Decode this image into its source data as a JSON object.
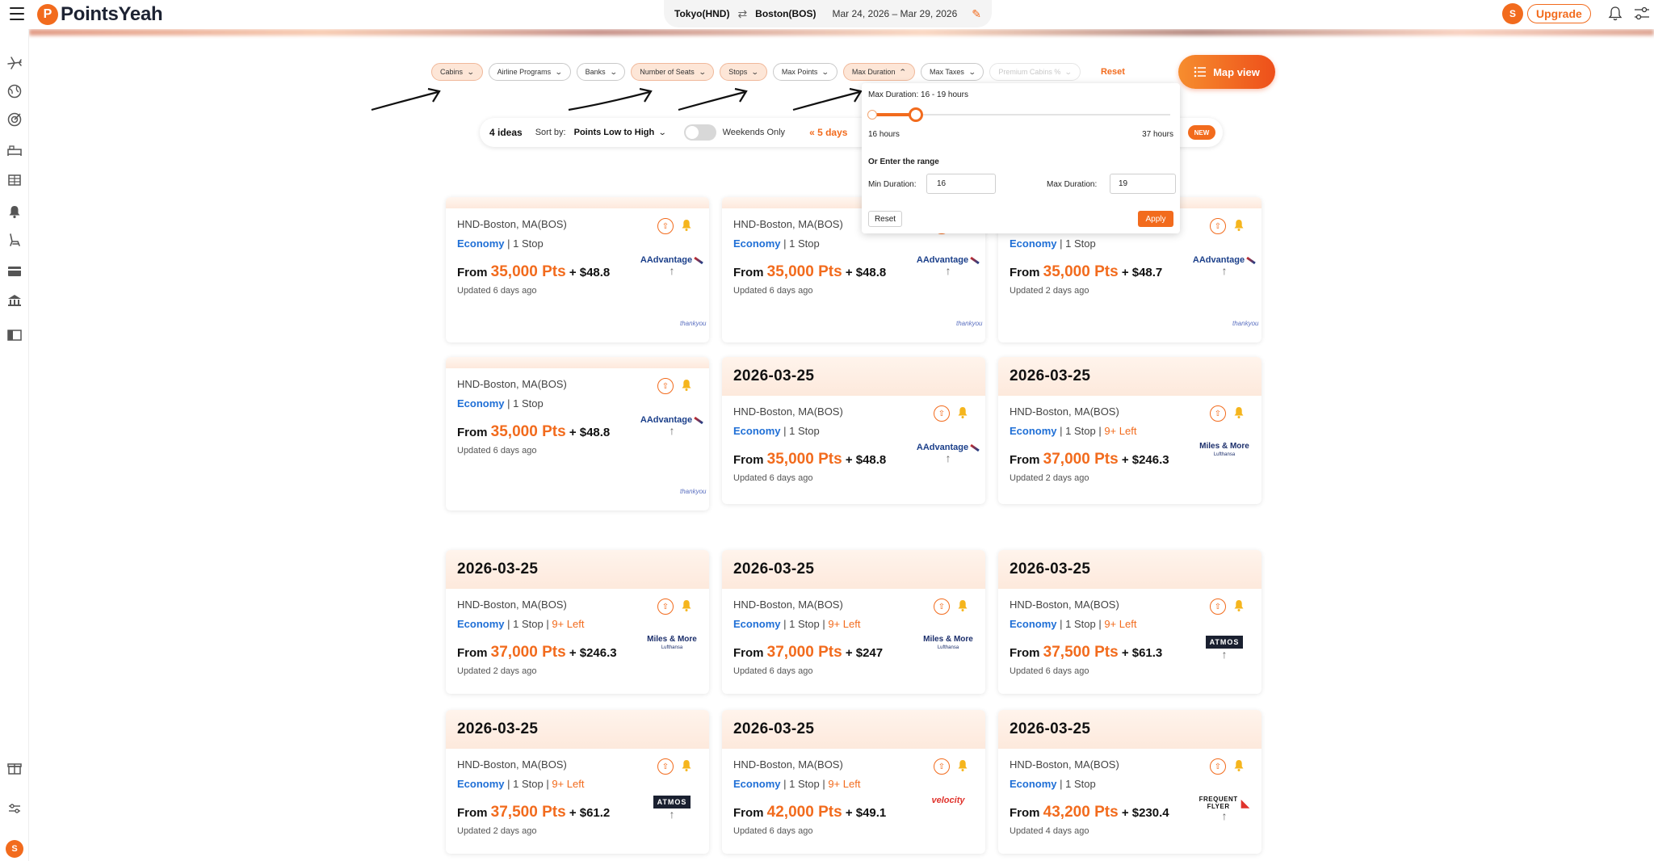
{
  "header": {
    "brand": "PointsYeah",
    "origin": "Tokyo(HND)",
    "destination": "Boston(BOS)",
    "date_range": "Mar 24, 2026 – Mar 29, 2026",
    "user_initial": "S",
    "upgrade_label": "Upgrade"
  },
  "filters": {
    "chips": [
      {
        "label": "Cabins",
        "state": "active"
      },
      {
        "label": "Airline Programs",
        "state": "default"
      },
      {
        "label": "Banks",
        "state": "default"
      },
      {
        "label": "Number of Seats",
        "state": "active"
      },
      {
        "label": "Stops",
        "state": "active"
      },
      {
        "label": "Max Points",
        "state": "default"
      },
      {
        "label": "Max Duration",
        "state": "active-open"
      },
      {
        "label": "Max Taxes",
        "state": "default"
      },
      {
        "label": "Premium Cabins %",
        "state": "disabled"
      }
    ],
    "reset_label": "Reset",
    "map_view_label": "Map view"
  },
  "results_bar": {
    "count": "4 ideas",
    "sort_label": "Sort by:",
    "sort_value": "Points Low to High",
    "weekends_label": "Weekends Only",
    "weekends_on": false,
    "days_label": "5 days",
    "new_badge": "NEW"
  },
  "duration_dropdown": {
    "title": "Max Duration:  16 -  19 hours",
    "min_label": "16 hours",
    "max_label": "37 hours",
    "slider_min_hours": 16,
    "slider_max_hours": 37,
    "selected_low": 16,
    "selected_high": 19,
    "range_heading": "Or Enter the range",
    "min_field_label": "Min Duration:",
    "min_value": "16",
    "max_field_label": "Max Duration:",
    "max_value": "19",
    "reset_label": "Reset",
    "apply_label": "Apply"
  },
  "cards": [
    {
      "date": "",
      "route": "HND-Boston, MA(BOS)",
      "cabin": "Economy",
      "stops": "1 Stop",
      "left": "",
      "from": "From",
      "points": "35,000 Pts",
      "taxes": "+ $48.8",
      "updated": "Updated 6 days ago",
      "program": "AAdvantage",
      "via": "thankyou"
    },
    {
      "date": "",
      "route": "HND-Boston, MA(BOS)",
      "cabin": "Economy",
      "stops": "1 Stop",
      "left": "",
      "from": "From",
      "points": "35,000 Pts",
      "taxes": "+ $48.8",
      "updated": "Updated 6 days ago",
      "program": "AAdvantage",
      "via": "thankyou"
    },
    {
      "date": "",
      "route": "",
      "cabin": "Economy",
      "stops": "1 Stop",
      "left": "",
      "from": "From",
      "points": "35,000 Pts",
      "taxes": "+ $48.7",
      "updated": "Updated 2 days ago",
      "program": "AAdvantage",
      "via": "thankyou"
    },
    {
      "date": "",
      "route": "HND-Boston, MA(BOS)",
      "cabin": "Economy",
      "stops": "1 Stop",
      "left": "",
      "from": "From",
      "points": "35,000 Pts",
      "taxes": "+ $48.8",
      "updated": "Updated 6 days ago",
      "program": "AAdvantage",
      "via": "thankyou"
    },
    {
      "date": "2026-03-25",
      "route": "HND-Boston, MA(BOS)",
      "cabin": "Economy",
      "stops": "1 Stop",
      "left": "",
      "from": "From",
      "points": "35,000 Pts",
      "taxes": "+ $48.8",
      "updated": "Updated 6 days ago",
      "program": "AAdvantage",
      "via": ""
    },
    {
      "date": "2026-03-25",
      "route": "HND-Boston, MA(BOS)",
      "cabin": "Economy",
      "stops": "1 Stop",
      "left": "9+ Left",
      "from": "From",
      "points": "37,000 Pts",
      "taxes": "+ $246.3",
      "updated": "Updated 2 days ago",
      "program": "Miles & More",
      "via": ""
    },
    {
      "date": "2026-03-25",
      "route": "HND-Boston, MA(BOS)",
      "cabin": "Economy",
      "stops": "1 Stop",
      "left": "9+ Left",
      "from": "From",
      "points": "37,000 Pts",
      "taxes": "+ $246.3",
      "updated": "Updated 2 days ago",
      "program": "Miles & More",
      "via": ""
    },
    {
      "date": "2026-03-25",
      "route": "HND-Boston, MA(BOS)",
      "cabin": "Economy",
      "stops": "1 Stop",
      "left": "9+ Left",
      "from": "From",
      "points": "37,000 Pts",
      "taxes": "+ $247",
      "updated": "Updated 6 days ago",
      "program": "Miles & More",
      "via": ""
    },
    {
      "date": "2026-03-25",
      "route": "HND-Boston, MA(BOS)",
      "cabin": "Economy",
      "stops": "1 Stop",
      "left": "9+ Left",
      "from": "From",
      "points": "37,500 Pts",
      "taxes": "+ $61.3",
      "updated": "Updated 6 days ago",
      "program": "ATMOS",
      "via": ""
    },
    {
      "date": "2026-03-25",
      "route": "HND-Boston, MA(BOS)",
      "cabin": "Economy",
      "stops": "1 Stop",
      "left": "9+ Left",
      "from": "From",
      "points": "37,500 Pts",
      "taxes": "+ $61.2",
      "updated": "Updated 2 days ago",
      "program": "ATMOS",
      "via": ""
    },
    {
      "date": "2026-03-25",
      "route": "HND-Boston, MA(BOS)",
      "cabin": "Economy",
      "stops": "1 Stop",
      "left": "9+ Left",
      "from": "From",
      "points": "42,000 Pts",
      "taxes": "+ $49.1",
      "updated": "Updated 6 days ago",
      "program": "velocity",
      "via": ""
    },
    {
      "date": "2026-03-25",
      "route": "HND-Boston, MA(BOS)",
      "cabin": "Economy",
      "stops": "1 Stop",
      "left": "",
      "from": "From",
      "points": "43,200 Pts",
      "taxes": "+ $230.4",
      "updated": "Updated 4 days ago",
      "program": "FREQUENT FLYER",
      "via": ""
    }
  ],
  "colors": {
    "accent": "#f26b1d",
    "cabin": "#1f6fd6",
    "card_header": "#fde9dc"
  },
  "rail_icons": [
    "plane-icon",
    "globe-icon",
    "target-icon",
    "hotel-icon",
    "train-icon",
    "bell-icon",
    "seat-icon",
    "card-icon",
    "bank-icon",
    "book-icon",
    "gift-icon",
    "settings-icon"
  ]
}
